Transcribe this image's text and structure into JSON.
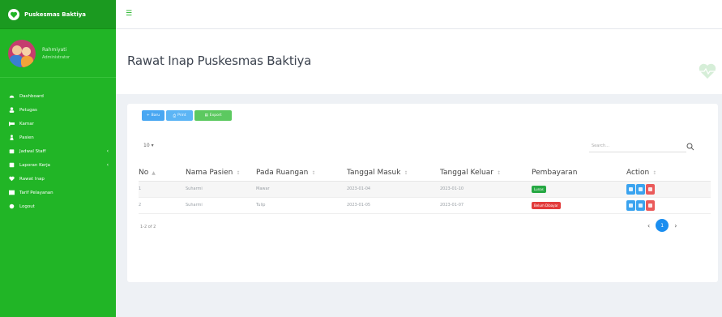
{
  "brand": {
    "name": "Puskesmas Baktiya"
  },
  "user": {
    "name": "Rahmiyati",
    "role": "Administrator"
  },
  "nav": [
    {
      "label": "Dashboard",
      "icon": "dashboard-icon",
      "has_children": false
    },
    {
      "label": "Petugas",
      "icon": "user-icon",
      "has_children": false
    },
    {
      "label": "Kamar",
      "icon": "bed-icon",
      "has_children": false
    },
    {
      "label": "Pasien",
      "icon": "patient-icon",
      "has_children": false
    },
    {
      "label": "Jadwal Staff",
      "icon": "calendar-icon",
      "has_children": true
    },
    {
      "label": "Laporan Kerja",
      "icon": "report-icon",
      "has_children": true
    },
    {
      "label": "Rawat Inap",
      "icon": "heart-icon",
      "has_children": false
    },
    {
      "label": "Tarif Pelayanan",
      "icon": "table-icon",
      "has_children": false
    },
    {
      "label": "Logout",
      "icon": "logout-icon",
      "has_children": false
    }
  ],
  "topbar": {
    "toggle_glyph": "☰"
  },
  "page": {
    "title": "Rawat Inap Puskesmas Baktiya"
  },
  "toolbar": {
    "new_label": "Baru",
    "print_label": "Print",
    "export_label": "Export"
  },
  "table_controls": {
    "length_value": "10",
    "search_placeholder": "Search..."
  },
  "table": {
    "columns": [
      "No",
      "Nama Pasien",
      "Pada Ruangan",
      "Tanggal Masuk",
      "Tanggal Keluar",
      "Pembayaran",
      "Action"
    ],
    "rows": [
      {
        "no": "1",
        "nama": "Suharmi",
        "ruangan": "Mawar",
        "masuk": "2023-01-04",
        "keluar": "2023-01-10",
        "bayar": "Lunas",
        "bayar_status": "green"
      },
      {
        "no": "2",
        "nama": "Suharmi",
        "ruangan": "Tulip",
        "masuk": "2023-01-05",
        "keluar": "2023-01-07",
        "bayar": "Belum Dibayar",
        "bayar_status": "red"
      }
    ]
  },
  "pagination": {
    "info": "1-2 of 2",
    "current_page": "1",
    "prev": "‹",
    "next": "›"
  },
  "colors": {
    "sidebar": "#21b526",
    "brand_bar": "#1b9a20",
    "accent_blue": "#1b8ef0",
    "danger": "#e23b3b"
  }
}
